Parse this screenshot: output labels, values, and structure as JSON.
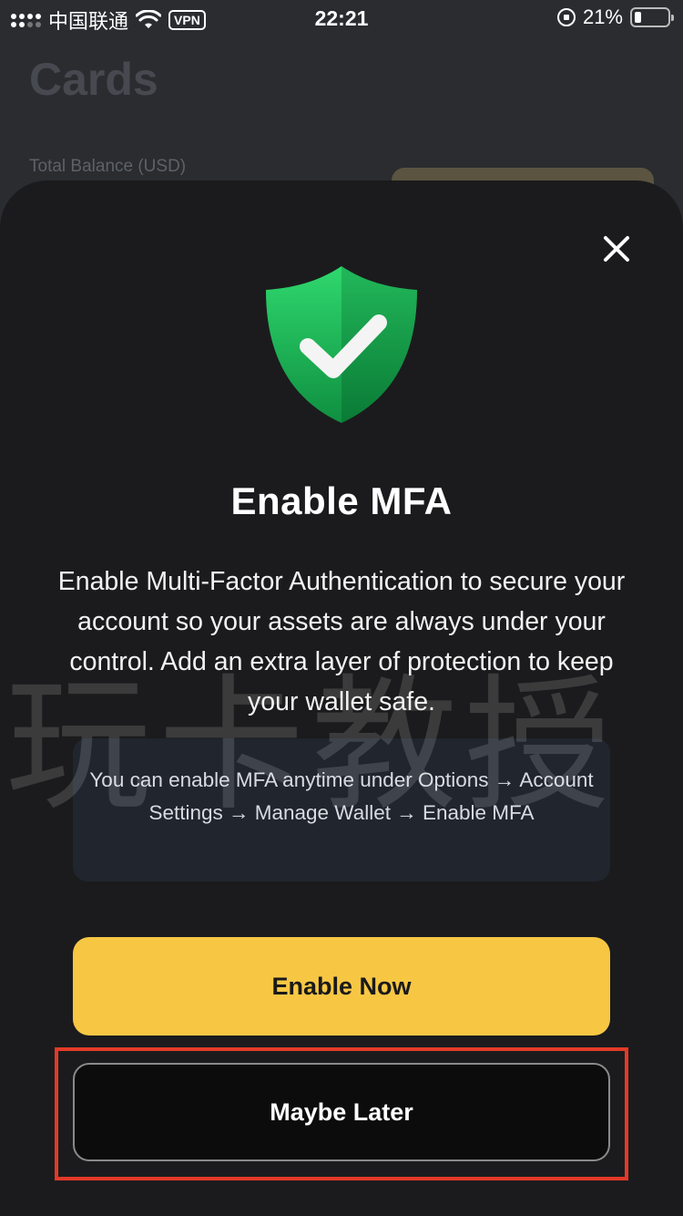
{
  "status_bar": {
    "carrier": "中国联通",
    "vpn": "VPN",
    "time": "22:21",
    "battery_text": "21%",
    "battery_level": 0.21
  },
  "background": {
    "title": "Cards",
    "balance_label": "Total Balance (USD)"
  },
  "modal": {
    "title": "Enable MFA",
    "description": "Enable Multi-Factor Authentication to secure your account so your assets are always under your control. Add an extra layer of protection to keep your wallet safe.",
    "hint": "You can enable MFA anytime under Options → Account Settings → Manage Wallet → Enable MFA",
    "enable_button": "Enable Now",
    "later_button": "Maybe Later",
    "watermark": "玩卡教授"
  },
  "colors": {
    "accent": "#f7c744",
    "sheet_bg": "#1b1b1d",
    "highlight": "#e23a28",
    "shield_green": "#1fbf5c"
  },
  "icons": {
    "close": "close-icon",
    "shield": "shield-check-icon",
    "wifi": "wifi-icon"
  }
}
